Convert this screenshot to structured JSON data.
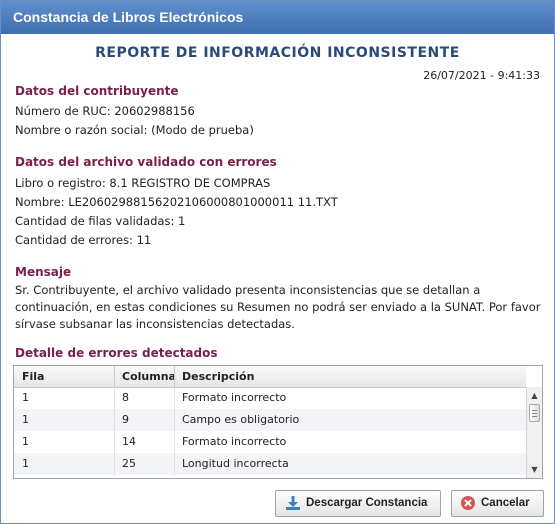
{
  "window": {
    "title": "Constancia de Libros Electrónicos"
  },
  "report": {
    "title": "REPORTE DE INFORMACIÓN INCONSISTENTE",
    "timestamp": "26/07/2021 - 9:41:33"
  },
  "contribuyente": {
    "heading": "Datos del contribuyente",
    "ruc": "Número de RUC: 20602988156",
    "nombre": "Nombre o razón social:  (Modo de prueba)"
  },
  "archivo": {
    "heading": "Datos del archivo validado con errores",
    "libro": "Libro o registro: 8.1 REGISTRO DE COMPRAS",
    "nombre": "Nombre: LE20602988156202106000801000011 11.TXT",
    "filas": "Cantidad de filas validadas: 1",
    "errores": "Cantidad de errores: 11"
  },
  "mensaje": {
    "heading": "Mensaje",
    "text": "Sr. Contribuyente, el archivo validado presenta inconsistencias que se detallan a continuación, en estas condiciones su Resumen no podrá ser enviado a la SUNAT. Por favor sírvase subsanar las inconsistencias detectadas."
  },
  "errores": {
    "heading": "Detalle de errores detectados",
    "columns": [
      "Fila",
      "Columna",
      "Descripción"
    ],
    "rows": [
      [
        "1",
        "8",
        "Formato incorrecto"
      ],
      [
        "1",
        "9",
        "Campo es obligatorio"
      ],
      [
        "1",
        "14",
        "Formato incorrecto"
      ],
      [
        "1",
        "25",
        "Longitud incorrecta"
      ]
    ]
  },
  "buttons": {
    "download": "Descargar Constancia",
    "cancel": "Cancelar"
  },
  "colors": {
    "titlebar": "#4a7bbd",
    "section": "#7a1f4a",
    "report_title": "#2a4a7a"
  },
  "icons": {
    "download": "download-icon",
    "cancel": "close-icon"
  }
}
